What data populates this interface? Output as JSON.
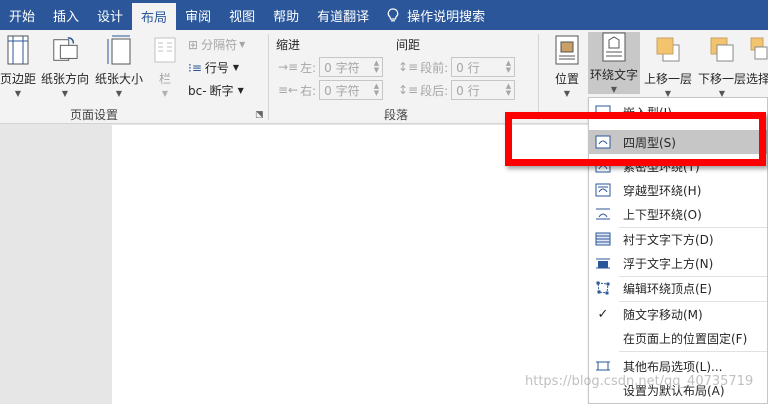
{
  "tabs": [
    "开始",
    "插入",
    "设计",
    "布局",
    "审阅",
    "视图",
    "帮助",
    "有道翻译",
    "操作说明搜索"
  ],
  "active_tab_index": 3,
  "page_setup": {
    "margins": "页边距",
    "orientation": "纸张方向",
    "size": "纸张大小",
    "columns": "栏",
    "breaks": "分隔符",
    "line_numbers": "行号",
    "hyphenation": "断字",
    "group_label": "页面设置"
  },
  "paragraph": {
    "indent_header": "缩进",
    "spacing_header": "间距",
    "left_label": "左:",
    "right_label": "右:",
    "before_label": "段前:",
    "after_label": "段后:",
    "left_value": "0 字符",
    "right_value": "0 字符",
    "before_value": "0 行",
    "after_value": "0 行",
    "group_label": "段落"
  },
  "arrange": {
    "position": "位置",
    "wrap_text": "环绕文字",
    "bring_forward": "上移一层",
    "send_backward": "下移一层",
    "select_pane": "选择"
  },
  "wrap_menu": {
    "items": [
      {
        "label": "嵌入型(I)",
        "icon": "inline-icon"
      },
      {
        "label": "四周型(S)",
        "icon": "square-wrap-icon",
        "selected": true
      },
      {
        "label": "紧密型环绕(T)",
        "icon": "tight-wrap-icon"
      },
      {
        "label": "穿越型环绕(H)",
        "icon": "through-wrap-icon"
      },
      {
        "label": "上下型环绕(O)",
        "icon": "top-bottom-icon"
      },
      {
        "label": "衬于文字下方(D)",
        "icon": "behind-text-icon"
      },
      {
        "label": "浮于文字上方(N)",
        "icon": "in-front-icon"
      },
      {
        "label": "编辑环绕顶点(E)",
        "icon": "edit-points-icon"
      },
      {
        "label": "随文字移动(M)",
        "icon": "checkmark-icon",
        "checked": true
      },
      {
        "label": "在页面上的位置固定(F)",
        "icon": ""
      },
      {
        "label": "其他布局选项(L)...",
        "icon": "layout-options-icon"
      },
      {
        "label": "设置为默认布局(A)",
        "icon": ""
      }
    ]
  },
  "watermark": "https://blog.csdn.net/qq_40735719"
}
